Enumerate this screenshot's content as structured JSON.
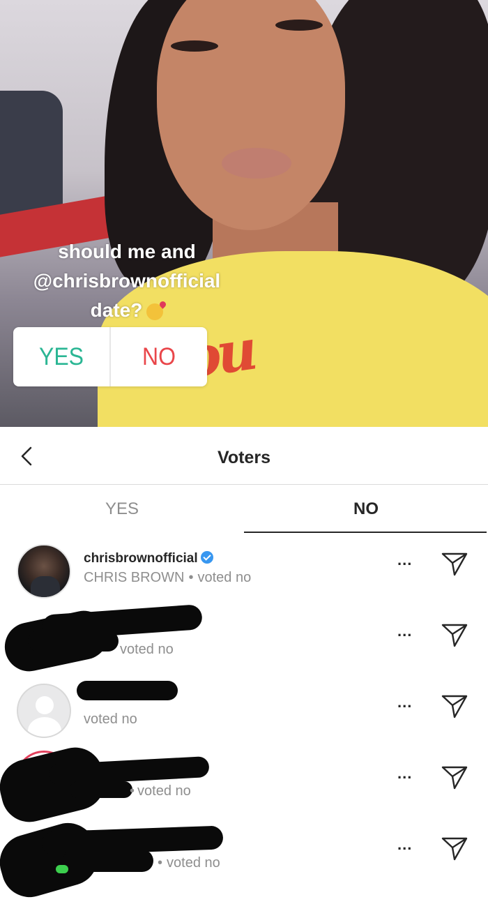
{
  "story": {
    "question_line1": "should me and",
    "question_line2": "@chrisbrownofficial",
    "question_line3": "date?",
    "emoji": "kissing-face",
    "poll": {
      "yes_label": "YES",
      "no_label": "NO"
    },
    "shirt_print": "ou"
  },
  "header": {
    "title": "Voters"
  },
  "tabs": [
    {
      "label": "YES",
      "active": false
    },
    {
      "label": "NO",
      "active": true
    }
  ],
  "voters": [
    {
      "username": "chrisbrownofficial",
      "verified": true,
      "full_name": "CHRIS BROWN",
      "status": "voted no",
      "avatar": "photo"
    },
    {
      "username": "",
      "verified": false,
      "full_name": "",
      "status": "voted no",
      "avatar": "redacted"
    },
    {
      "username": "",
      "verified": false,
      "full_name": "",
      "status": "voted no",
      "avatar": "blank"
    },
    {
      "username": "",
      "verified": false,
      "full_name": "",
      "status": "voted no",
      "avatar": "redacted"
    },
    {
      "username": "",
      "verified": false,
      "full_name": "",
      "status": "voted no",
      "avatar": "redacted"
    }
  ],
  "row_actions": {
    "more_label": "...",
    "more_icon": "more-icon",
    "send_icon": "send-icon"
  },
  "colors": {
    "yes": "#2bb694",
    "no": "#e9464a",
    "verified": "#3897f0",
    "tab_active": "#262626",
    "muted": "#8e8e8e"
  }
}
